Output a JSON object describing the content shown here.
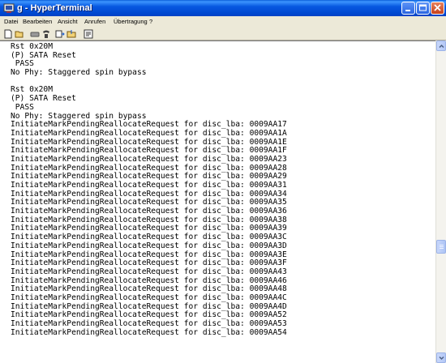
{
  "window": {
    "title": "g - HyperTerminal"
  },
  "menu": {
    "items": [
      "Datei",
      "Bearbeiten",
      "Ansicht",
      "Anrufen",
      "Übertragung",
      "?"
    ]
  },
  "toolbar": {
    "icons": [
      "new-icon",
      "open-icon",
      "disconnect-icon",
      "call-icon",
      "send-icon",
      "receive-icon",
      "properties-icon"
    ]
  },
  "terminal": {
    "lines": [
      "Rst 0x20M",
      "(P) SATA Reset",
      " PASS",
      "No Phy: Staggered spin bypass",
      "",
      "Rst 0x20M",
      "(P) SATA Reset",
      " PASS",
      "No Phy: Staggered spin bypass",
      "InitiateMarkPendingReallocateRequest for disc_lba: 0009AA17",
      "InitiateMarkPendingReallocateRequest for disc_lba: 0009AA1A",
      "InitiateMarkPendingReallocateRequest for disc_lba: 0009AA1E",
      "InitiateMarkPendingReallocateRequest for disc_lba: 0009AA1F",
      "InitiateMarkPendingReallocateRequest for disc_lba: 0009AA23",
      "InitiateMarkPendingReallocateRequest for disc_lba: 0009AA28",
      "InitiateMarkPendingReallocateRequest for disc_lba: 0009AA29",
      "InitiateMarkPendingReallocateRequest for disc_lba: 0009AA31",
      "InitiateMarkPendingReallocateRequest for disc_lba: 0009AA34",
      "InitiateMarkPendingReallocateRequest for disc_lba: 0009AA35",
      "InitiateMarkPendingReallocateRequest for disc_lba: 0009AA36",
      "InitiateMarkPendingReallocateRequest for disc_lba: 0009AA38",
      "InitiateMarkPendingReallocateRequest for disc_lba: 0009AA39",
      "InitiateMarkPendingReallocateRequest for disc_lba: 0009AA3C",
      "InitiateMarkPendingReallocateRequest for disc_lba: 0009AA3D",
      "InitiateMarkPendingReallocateRequest for disc_lba: 0009AA3E",
      "InitiateMarkPendingReallocateRequest for disc_lba: 0009AA3F",
      "InitiateMarkPendingReallocateRequest for disc_lba: 0009AA43",
      "InitiateMarkPendingReallocateRequest for disc_lba: 0009AA46",
      "InitiateMarkPendingReallocateRequest for disc_lba: 0009AA48",
      "InitiateMarkPendingReallocateRequest for disc_lba: 0009AA4C",
      "InitiateMarkPendingReallocateRequest for disc_lba: 0009AA4D",
      "InitiateMarkPendingReallocateRequest for disc_lba: 0009AA52",
      "InitiateMarkPendingReallocateRequest for disc_lba: 0009AA53",
      "InitiateMarkPendingReallocateRequest for disc_lba: 0009AA54"
    ]
  },
  "colors": {
    "title_bar": "#0054E3",
    "terminal_bg": "#FFFFFF",
    "terminal_text": "#000000",
    "chrome": "#ECE9D8"
  }
}
